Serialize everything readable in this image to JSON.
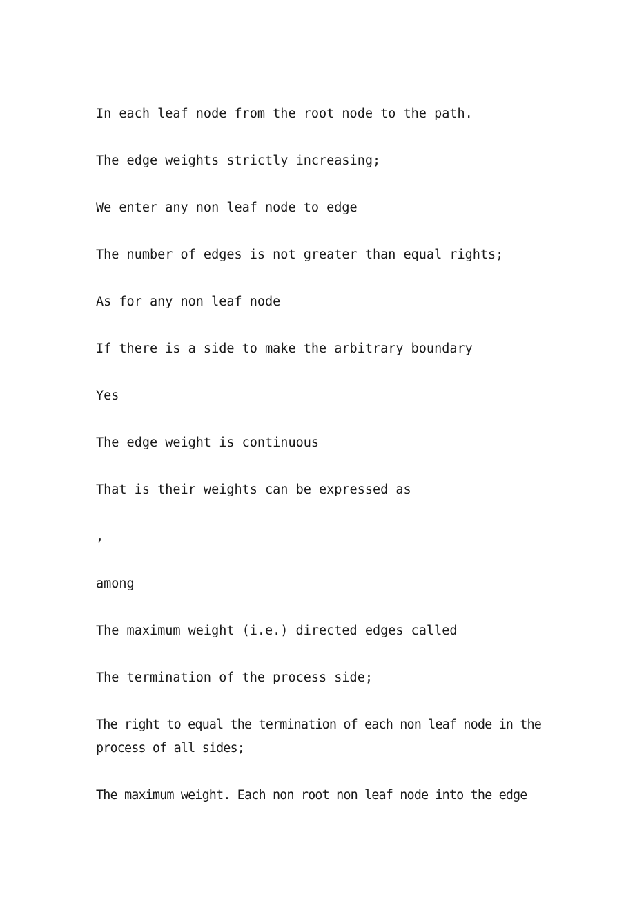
{
  "document": {
    "paragraphs": [
      "In each leaf node from the root node to the path.",
      "The edge weights strictly increasing;",
      "We enter any non leaf node to edge",
      "The number of edges is not greater than equal rights;",
      "As for any non leaf node",
      "If there is a side to make the arbitrary boundary",
      "Yes",
      "The edge weight is continuous",
      "That is their weights can be expressed as",
      ",",
      "among",
      "The maximum weight (i.e.) directed edges called",
      "The termination of the process side;",
      "The right to equal the termination of each non leaf node in the process of all sides;",
      "The maximum weight. Each non root non leaf node into the edge"
    ]
  }
}
